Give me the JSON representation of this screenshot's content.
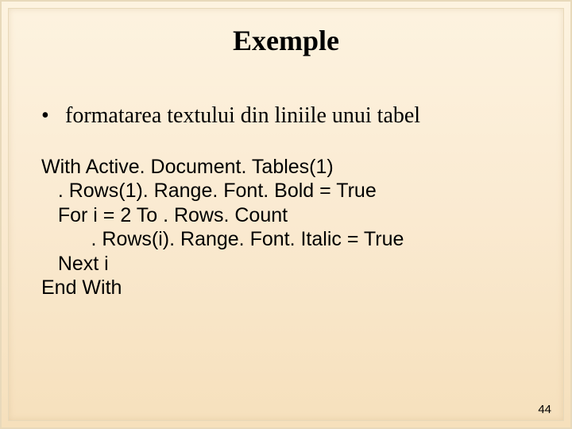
{
  "title": "Exemple",
  "bullet": {
    "marker": "•",
    "text": "formatarea textului din liniile unui tabel"
  },
  "code": {
    "l1": "With Active. Document. Tables(1)",
    "l2": "   . Rows(1). Range. Font. Bold = True",
    "l3": "   For i = 2 To . Rows. Count",
    "l4": "         . Rows(i). Range. Font. Italic = True",
    "l5": "   Next i",
    "l6": "End With"
  },
  "page_number": "44"
}
